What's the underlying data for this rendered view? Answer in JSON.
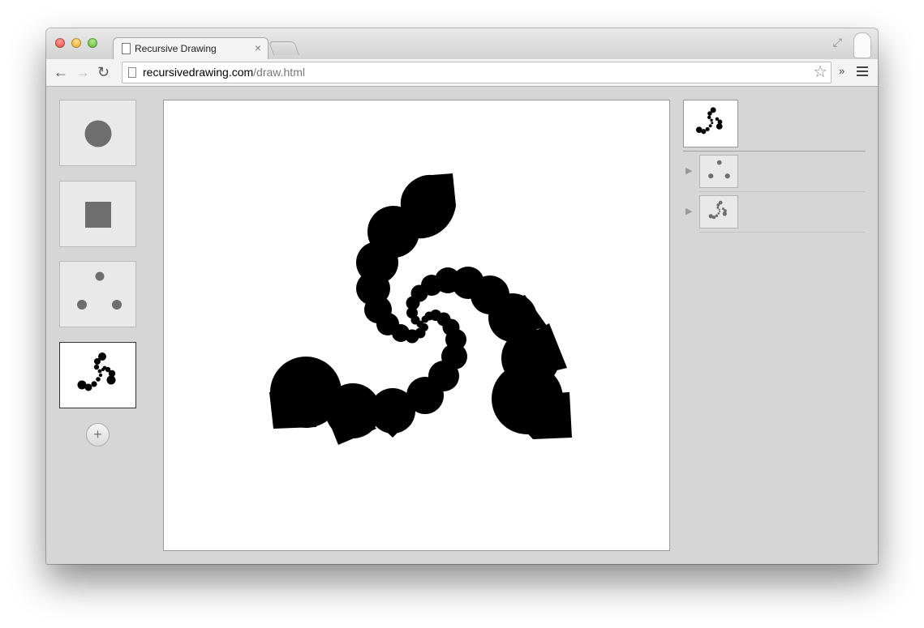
{
  "browser": {
    "tab_title": "Recursive Drawing",
    "tab_close": "×",
    "url_domain": "recursivedrawing.com",
    "url_path": "/draw.html",
    "back_icon": "←",
    "forward_icon": "→",
    "reload_icon": "↻",
    "star_icon": "☆",
    "extensions_icon": "»",
    "fullscreen_icon": "⤢"
  },
  "library": {
    "items": [
      {
        "name": "circle",
        "shape": "circle-icon"
      },
      {
        "name": "square",
        "shape": "square-icon"
      },
      {
        "name": "three-dots",
        "shape": "dots-icon"
      },
      {
        "name": "spiral",
        "shape": "spiral-icon",
        "selected": true
      }
    ],
    "add_label": "+"
  },
  "outline": {
    "arrow": "▶"
  },
  "colors": {
    "shape_fill": "#6e6e6e",
    "drawing_fill": "#000000",
    "canvas_background": "#ffffff",
    "panel_background": "#d6d6d6"
  }
}
